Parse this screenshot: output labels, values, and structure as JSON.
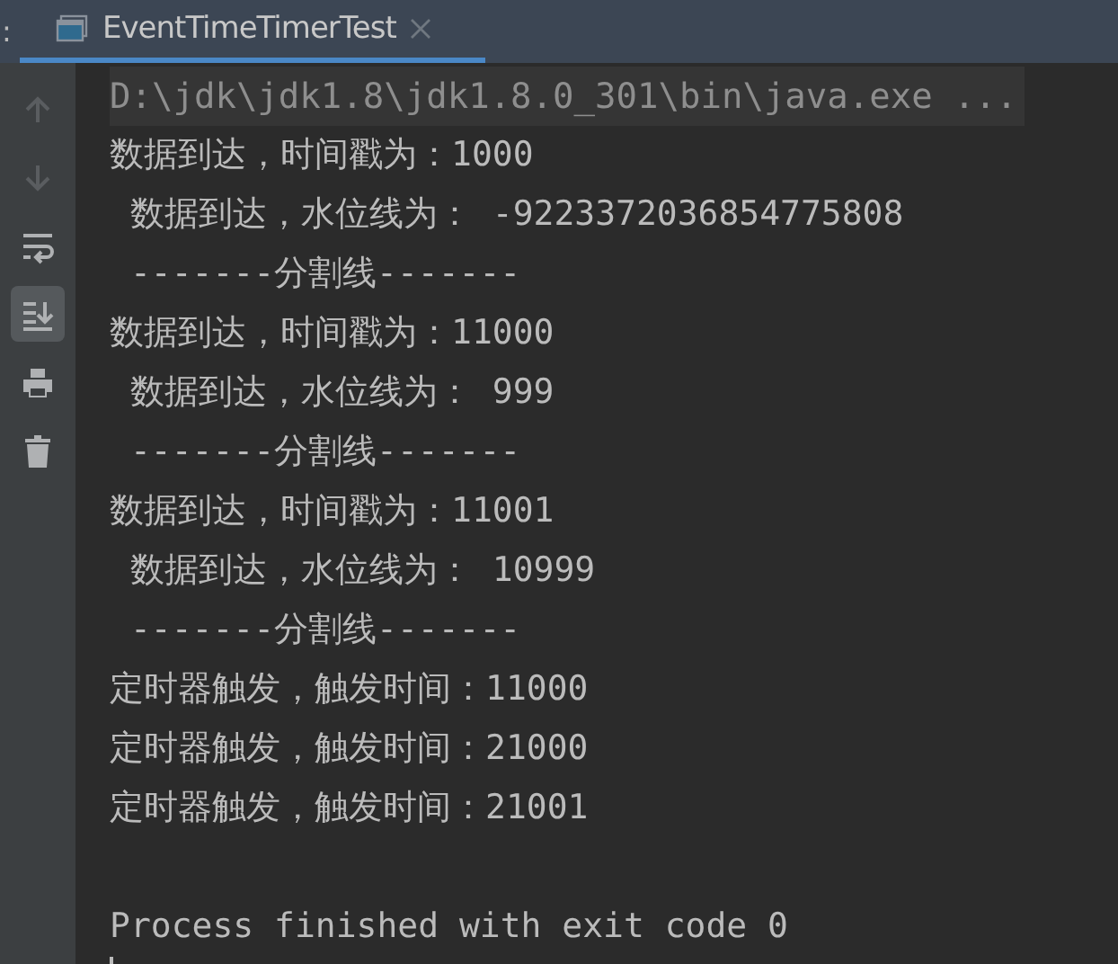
{
  "tool_window": {
    "label": ":"
  },
  "tabs": [
    {
      "label": "EventTimeTimerTest",
      "selected": true
    }
  ],
  "toolbar": [
    {
      "kind": "up",
      "disabled": true,
      "on": false
    },
    {
      "kind": "down",
      "disabled": true,
      "on": false
    },
    {
      "kind": "wrap",
      "disabled": false,
      "on": false
    },
    {
      "kind": "scroll-end",
      "disabled": false,
      "on": true
    },
    {
      "kind": "print",
      "disabled": false,
      "on": false
    },
    {
      "kind": "trash",
      "disabled": false,
      "on": false
    }
  ],
  "console": {
    "command": "D:\\jdk\\jdk1.8\\jdk1.8.0_301\\bin\\java.exe ...",
    "lines": [
      {
        "kind": "output",
        "text": "数据到达，时间戳为：1000"
      },
      {
        "kind": "output",
        "text": " 数据到达，水位线为： -9223372036854775808"
      },
      {
        "kind": "output",
        "text": " -------分割线-------"
      },
      {
        "kind": "output",
        "text": "数据到达，时间戳为：11000"
      },
      {
        "kind": "output",
        "text": " 数据到达，水位线为： 999"
      },
      {
        "kind": "output",
        "text": " -------分割线-------"
      },
      {
        "kind": "output",
        "text": "数据到达，时间戳为：11001"
      },
      {
        "kind": "output",
        "text": " 数据到达，水位线为： 10999"
      },
      {
        "kind": "output",
        "text": " -------分割线-------"
      },
      {
        "kind": "output",
        "text": "定时器触发，触发时间：11000"
      },
      {
        "kind": "output",
        "text": "定时器触发，触发时间：21000"
      },
      {
        "kind": "output",
        "text": "定时器触发，触发时间：21001"
      },
      {
        "kind": "status",
        "text": "Process finished with exit code 0"
      }
    ]
  }
}
